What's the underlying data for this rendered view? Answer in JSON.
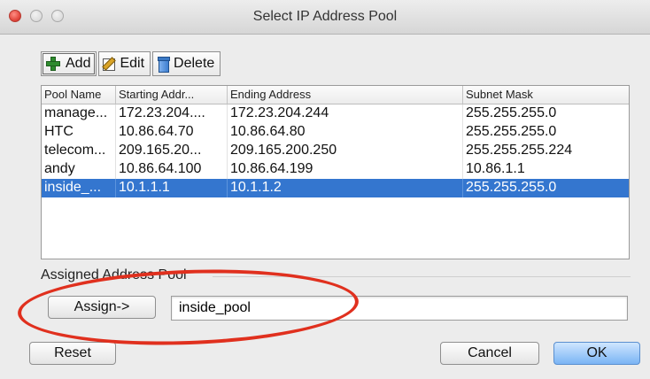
{
  "window": {
    "title": "Select IP Address Pool"
  },
  "toolbar": {
    "add_label": "Add",
    "edit_label": "Edit",
    "delete_label": "Delete"
  },
  "table": {
    "columns": [
      "Pool Name",
      "Starting Addr...",
      "Ending Address",
      "Subnet Mask"
    ],
    "rows": [
      [
        "manage...",
        "172.23.204....",
        "172.23.204.244",
        "255.255.255.0"
      ],
      [
        "HTC",
        "10.86.64.70",
        "10.86.64.80",
        "255.255.255.0"
      ],
      [
        "telecom...",
        "209.165.20...",
        "209.165.200.250",
        "255.255.255.224"
      ],
      [
        "andy",
        "10.86.64.100",
        "10.86.64.199",
        "10.86.1.1"
      ],
      [
        "inside_...",
        "10.1.1.1",
        "10.1.1.2",
        "255.255.255.0"
      ]
    ],
    "selected_row": 4
  },
  "assigned": {
    "section_label": "Assigned Address Pool",
    "assign_label": "Assign->",
    "pool_value": "inside_pool"
  },
  "footer": {
    "reset_label": "Reset",
    "cancel_label": "Cancel",
    "ok_label": "OK"
  },
  "icons": {
    "add": "plus-icon",
    "edit": "edit-icon",
    "delete": "trash-icon"
  },
  "colors": {
    "selection": "#3476cf",
    "annotation": "#e0301e",
    "ok_button": "#7ab4f4"
  }
}
